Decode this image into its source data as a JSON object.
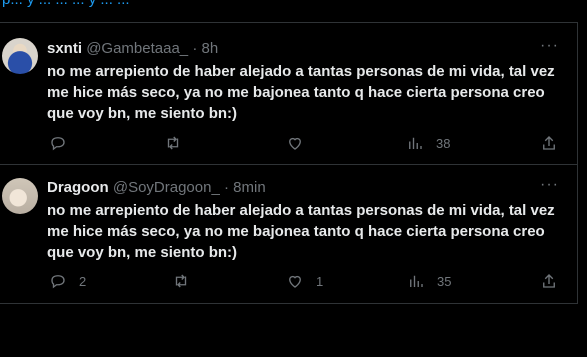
{
  "top_link_fragment": "p... y ... ... ... y ... ...",
  "tweets": [
    {
      "name": "sxnti",
      "handle": "@Gambetaaa_",
      "separator": "·",
      "time": "8h",
      "more": "···",
      "text": "no me arrepiento de haber alejado a tantas personas de mi vida, tal vez me hice más seco, ya no me bajonea tanto q hace cierta persona creo que voy bn, me siento bn:)",
      "replies": "",
      "retweets": "",
      "likes": "",
      "views": "38"
    },
    {
      "name": "Dragoon",
      "handle": "@SoyDragoon_",
      "separator": "·",
      "time": "8min",
      "more": "···",
      "text": "no me arrepiento de haber alejado a tantas personas de mi vida, tal vez me hice más seco, ya no me bajonea tanto q hace cierta persona creo que voy bn, me siento bn:)",
      "replies": "2",
      "retweets": "",
      "likes": "1",
      "views": "35"
    }
  ],
  "icons": {
    "reply": "reply-icon",
    "retweet": "retweet-icon",
    "like": "like-icon",
    "views": "views-icon",
    "share": "share-icon",
    "more": "more-icon"
  },
  "colors": {
    "background": "#000000",
    "text": "#e7e9ea",
    "muted": "#71767b",
    "link": "#1d9bf0",
    "divider": "#2f3336"
  }
}
